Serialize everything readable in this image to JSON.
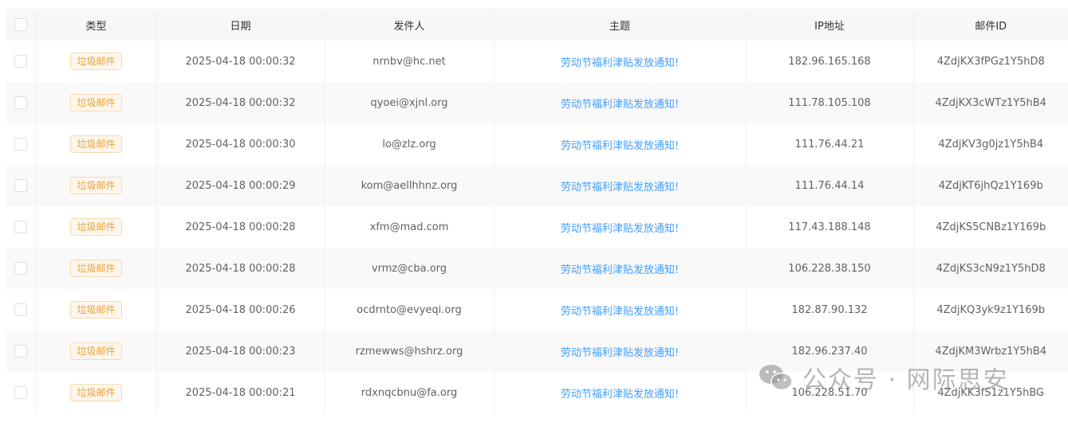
{
  "columns": [
    "类型",
    "日期",
    "发件人",
    "主题",
    "IP地址",
    "邮件ID"
  ],
  "rows": [
    {
      "type": "垃圾邮件",
      "date": "2025-04-18 00:00:32",
      "sender": "nrnbv@hc.net",
      "subject": "劳动节福利津贴发放通知!",
      "ip": "182.96.165.168",
      "mail_id": "4ZdjKX3fPGz1Y5hD8"
    },
    {
      "type": "垃圾邮件",
      "date": "2025-04-18 00:00:32",
      "sender": "qyoei@xjnl.org",
      "subject": "劳动节福利津贴发放通知!",
      "ip": "111.78.105.108",
      "mail_id": "4ZdjKX3cWTz1Y5hB4"
    },
    {
      "type": "垃圾邮件",
      "date": "2025-04-18 00:00:30",
      "sender": "lo@zlz.org",
      "subject": "劳动节福利津贴发放通知!",
      "ip": "111.76.44.21",
      "mail_id": "4ZdjKV3g0jz1Y5hB4"
    },
    {
      "type": "垃圾邮件",
      "date": "2025-04-18 00:00:29",
      "sender": "kom@aellhhnz.org",
      "subject": "劳动节福利津贴发放通知!",
      "ip": "111.76.44.14",
      "mail_id": "4ZdjKT6jhQz1Y169b"
    },
    {
      "type": "垃圾邮件",
      "date": "2025-04-18 00:00:28",
      "sender": "xfm@mad.com",
      "subject": "劳动节福利津贴发放通知!",
      "ip": "117.43.188.148",
      "mail_id": "4ZdjKS5CNBz1Y169b"
    },
    {
      "type": "垃圾邮件",
      "date": "2025-04-18 00:00:28",
      "sender": "vrmz@cba.org",
      "subject": "劳动节福利津贴发放通知!",
      "ip": "106.228.38.150",
      "mail_id": "4ZdjKS3cN9z1Y5hD8"
    },
    {
      "type": "垃圾邮件",
      "date": "2025-04-18 00:00:26",
      "sender": "ocdrnto@evyeqi.org",
      "subject": "劳动节福利津贴发放通知!",
      "ip": "182.87.90.132",
      "mail_id": "4ZdjKQ3yk9z1Y169b"
    },
    {
      "type": "垃圾邮件",
      "date": "2025-04-18 00:00:23",
      "sender": "rzmewws@hshrz.org",
      "subject": "劳动节福利津贴发放通知!",
      "ip": "182.96.237.40",
      "mail_id": "4ZdjKM3Wrbz1Y5hB4"
    },
    {
      "type": "垃圾邮件",
      "date": "2025-04-18 00:00:21",
      "sender": "rdxnqcbnu@fa.org",
      "subject": "劳动节福利津贴发放通知!",
      "ip": "106.228.51.70",
      "mail_id": "4ZdjKK3fS1z1Y5hBG"
    }
  ],
  "watermark": {
    "text": "公众号 · 网际思安",
    "icon": "wechat-icon"
  },
  "colors": {
    "tag_text": "#e6a23c",
    "tag_bg": "#fdf6ec",
    "tag_border": "#f5dab1",
    "link": "#409eff",
    "header_bg": "#f7f7f8",
    "stripe_bg": "#f9f9fa"
  }
}
